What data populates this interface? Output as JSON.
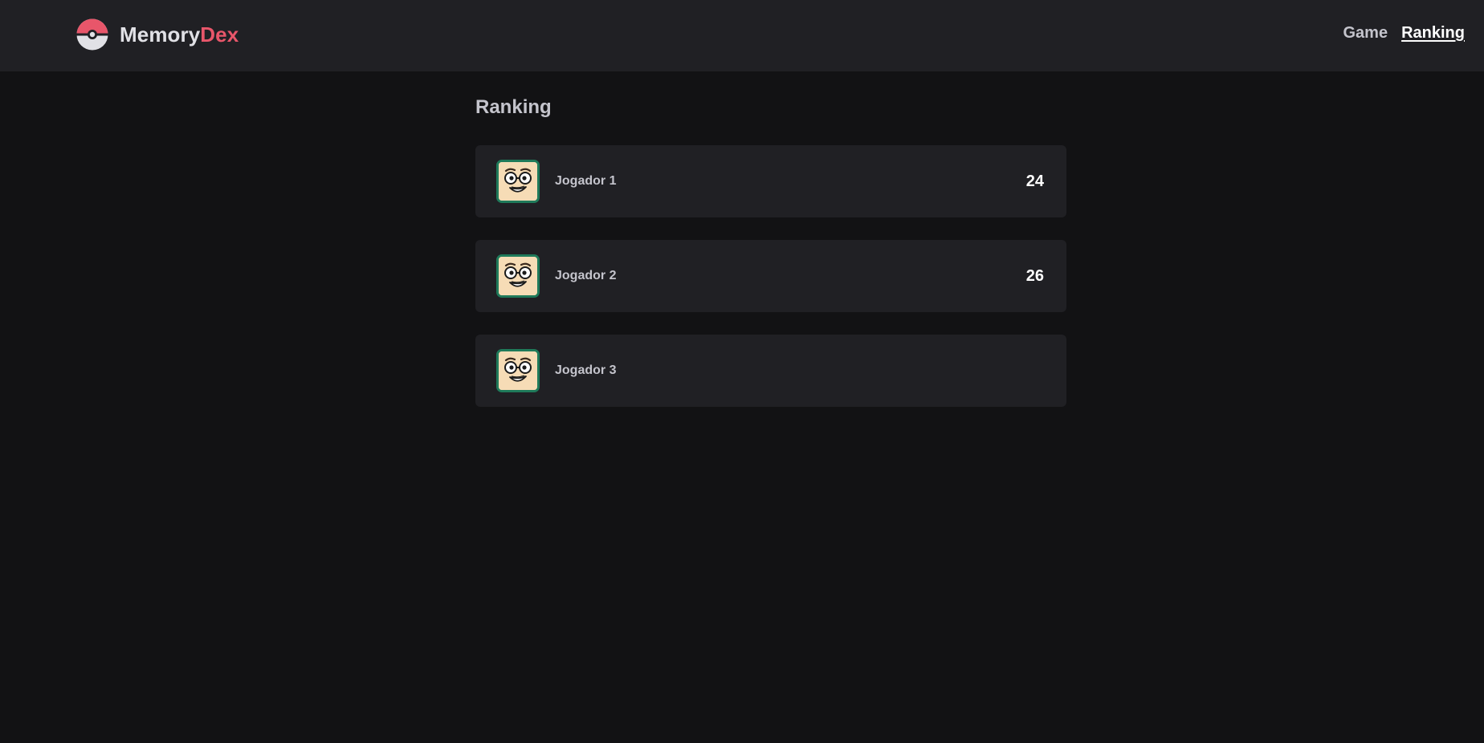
{
  "header": {
    "brand_main": "Memory",
    "brand_accent": "Dex",
    "logo_icon": "pokeball-icon",
    "nav": [
      {
        "label": "Game",
        "active": false
      },
      {
        "label": "Ranking",
        "active": true
      }
    ]
  },
  "main": {
    "title": "Ranking",
    "players": [
      {
        "name": "Jogador 1",
        "score": "24",
        "avatar_icon": "cartoon-face-avatar-icon"
      },
      {
        "name": "Jogador 2",
        "score": "26",
        "avatar_icon": "cartoon-face-avatar-icon"
      },
      {
        "name": "Jogador 3",
        "score": "",
        "avatar_icon": "cartoon-face-avatar-icon"
      }
    ]
  },
  "colors": {
    "background": "#121214",
    "surface": "#202024",
    "accent": "#e8566a",
    "text": "#c4c4cc",
    "avatar_border": "#1f7a5a",
    "avatar_skin": "#f6dcb6"
  }
}
